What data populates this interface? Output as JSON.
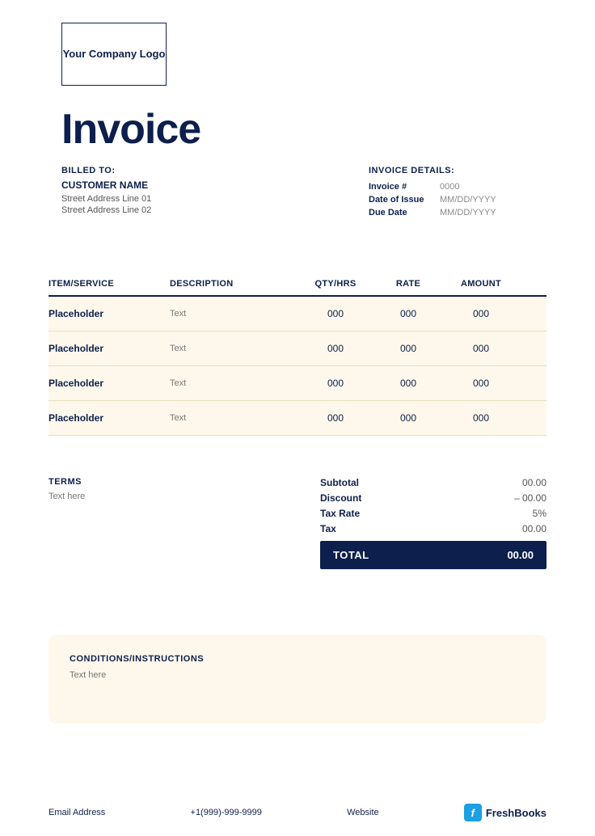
{
  "logo": {
    "text": "Your Company Logo"
  },
  "title": "Invoice",
  "billed": {
    "label": "BILLED TO:",
    "customer_name": "CUSTOMER NAME",
    "address_line1": "Street Address Line 01",
    "address_line2": "Street Address Line 02"
  },
  "invoice_details": {
    "label": "INVOICE DETAILS:",
    "invoice_number_label": "Invoice #",
    "invoice_number_value": "0000",
    "date_of_issue_label": "Date of Issue",
    "date_of_issue_value": "MM/DD/YYYY",
    "due_date_label": "Due Date",
    "due_date_value": "MM/DD/YYYY"
  },
  "table": {
    "headers": [
      "ITEM/SERVICE",
      "DESCRIPTION",
      "QTY/HRS",
      "RATE",
      "AMOUNT"
    ],
    "rows": [
      {
        "item": "Placeholder",
        "description": "Text",
        "qty": "000",
        "rate": "000",
        "amount": "000"
      },
      {
        "item": "Placeholder",
        "description": "Text",
        "qty": "000",
        "rate": "000",
        "amount": "000"
      },
      {
        "item": "Placeholder",
        "description": "Text",
        "qty": "000",
        "rate": "000",
        "amount": "000"
      },
      {
        "item": "Placeholder",
        "description": "Text",
        "qty": "000",
        "rate": "000",
        "amount": "000"
      }
    ]
  },
  "terms": {
    "title": "TERMS",
    "text": "Text here"
  },
  "totals": {
    "subtotal_label": "Subtotal",
    "subtotal_value": "00.00",
    "discount_label": "Discount",
    "discount_value": "– 00.00",
    "tax_rate_label": "Tax Rate",
    "tax_rate_value": "5%",
    "tax_label": "Tax",
    "tax_value": "00.00",
    "total_label": "TOTAL",
    "total_value": "00.00"
  },
  "conditions": {
    "title": "CONDITIONS/INSTRUCTIONS",
    "text": "Text here"
  },
  "footer": {
    "email": "Email Address",
    "phone": "+1(999)-999-9999",
    "website": "Website",
    "brand": "FreshBooks"
  }
}
